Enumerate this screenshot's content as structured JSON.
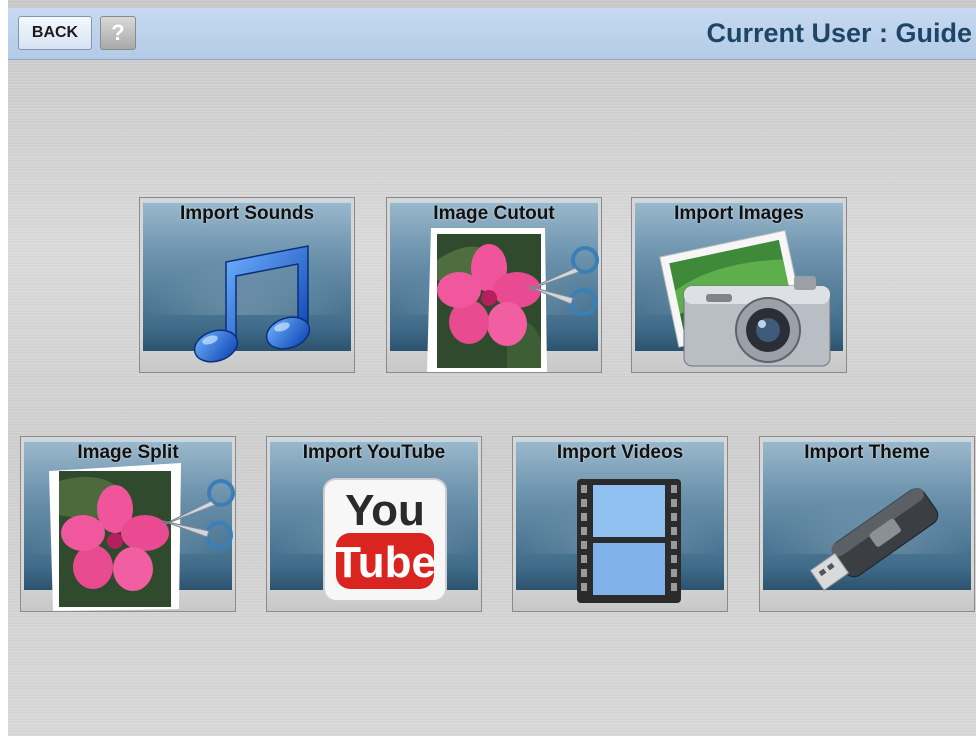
{
  "header": {
    "back_label": "BACK",
    "help_symbol": "?",
    "user_label": "Current User : Guide"
  },
  "tiles": [
    {
      "label": "Import Sounds",
      "icon": "music-note-icon"
    },
    {
      "label": "Image Cutout",
      "icon": "flower-scissors-icon"
    },
    {
      "label": "Import Images",
      "icon": "camera-photo-icon"
    },
    {
      "label": "Image Split",
      "icon": "flower-scissors-icon"
    },
    {
      "label": "Import YouTube",
      "icon": "youtube-icon"
    },
    {
      "label": "Import Videos",
      "icon": "film-strip-icon"
    },
    {
      "label": "Import Theme",
      "icon": "usb-drive-icon"
    }
  ],
  "youtube_logo": {
    "top": "You",
    "bottom": "Tube"
  },
  "colors": {
    "header_bg": "#b3cbe7",
    "header_text": "#1e4466",
    "tile_panel": "#4f7a98",
    "youtube_red": "#d9241f"
  }
}
